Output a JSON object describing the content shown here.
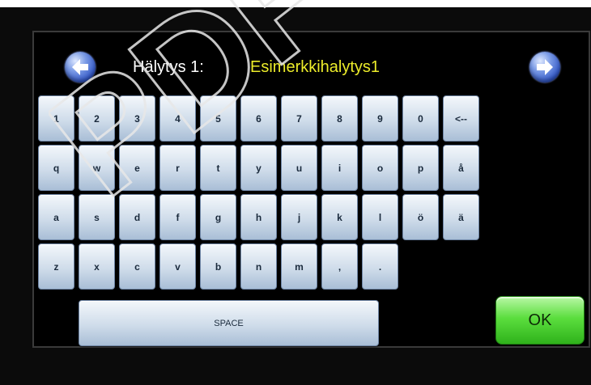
{
  "header": {
    "prev_icon": "arrow-left-icon",
    "next_icon": "arrow-right-icon",
    "alarm_label": "Hälytys 1:",
    "alarm_name": "Esimerkkihalytys1",
    "alarm_name_color": "#ecec2a"
  },
  "keyboard": {
    "rows": [
      [
        "1",
        "2",
        "3",
        "4",
        "5",
        "6",
        "7",
        "8",
        "9",
        "0",
        "<--"
      ],
      [
        "q",
        "w",
        "e",
        "r",
        "t",
        "y",
        "u",
        "i",
        "o",
        "p",
        "å"
      ],
      [
        "a",
        "s",
        "d",
        "f",
        "g",
        "h",
        "j",
        "k",
        "l",
        "ö",
        "ä"
      ],
      [
        "z",
        "x",
        "c",
        "v",
        "b",
        "n",
        "m",
        ",",
        "."
      ]
    ],
    "space_label": "SPACE",
    "ok_label": "OK",
    "ok_color": "#5bde3e"
  },
  "watermark": {
    "text": "PDF"
  }
}
